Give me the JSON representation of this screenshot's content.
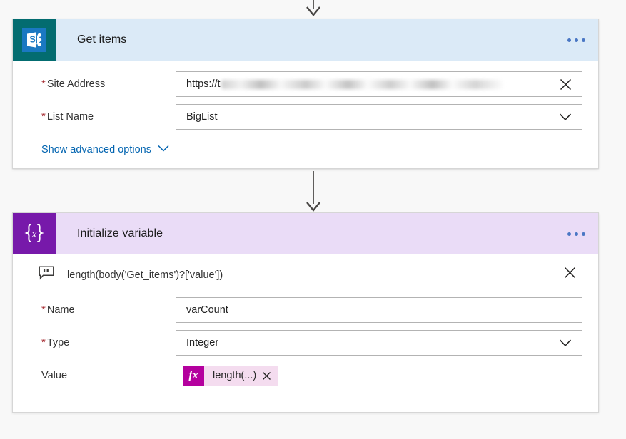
{
  "colors": {
    "sharepoint_tile": "#036c70",
    "sharepoint_header": "#dbeaf7",
    "variables_tile": "#7719aa",
    "variables_header": "#eadcf7",
    "required_asterisk": "#a4262c",
    "link_blue": "#0264b0",
    "ellipsis_blue": "#4a77c4",
    "fx_magenta": "#b4009e",
    "token_pink": "#f4dcef",
    "page_background": "#f8f8f8"
  },
  "flow": {
    "connector_top": "arrow-down",
    "connector_middle": "arrow-down"
  },
  "get_items_card": {
    "icon": "sharepoint-icon",
    "title": "Get items",
    "overflow_menu": "ellipsis-icon",
    "fields": [
      {
        "label": "Site Address",
        "required": true,
        "value": "https://t",
        "value_redacted": true,
        "trailing_icon": "clear-icon"
      },
      {
        "label": "List Name",
        "required": true,
        "value": "BigList",
        "value_redacted": false,
        "trailing_icon": "chevron-down-icon"
      }
    ],
    "advanced_link": "Show advanced options",
    "advanced_chevron": "chevron-down-icon"
  },
  "initialize_variable_card": {
    "icon": "variables-icon",
    "title": "Initialize variable",
    "overflow_menu": "ellipsis-icon",
    "comment": {
      "icon": "comment-icon",
      "text": "length(body('Get_items')?['value'])",
      "trailing_icon": "close-icon"
    },
    "fields": [
      {
        "label": "Name",
        "required": true,
        "value": "varCount",
        "trailing_icon": "none"
      },
      {
        "label": "Type",
        "required": true,
        "value": "Integer",
        "trailing_icon": "chevron-down-icon"
      }
    ],
    "value_field": {
      "label": "Value",
      "required": false,
      "token": {
        "badge": "fx",
        "label": "length(...)",
        "remove_icon": "close-icon"
      }
    }
  }
}
